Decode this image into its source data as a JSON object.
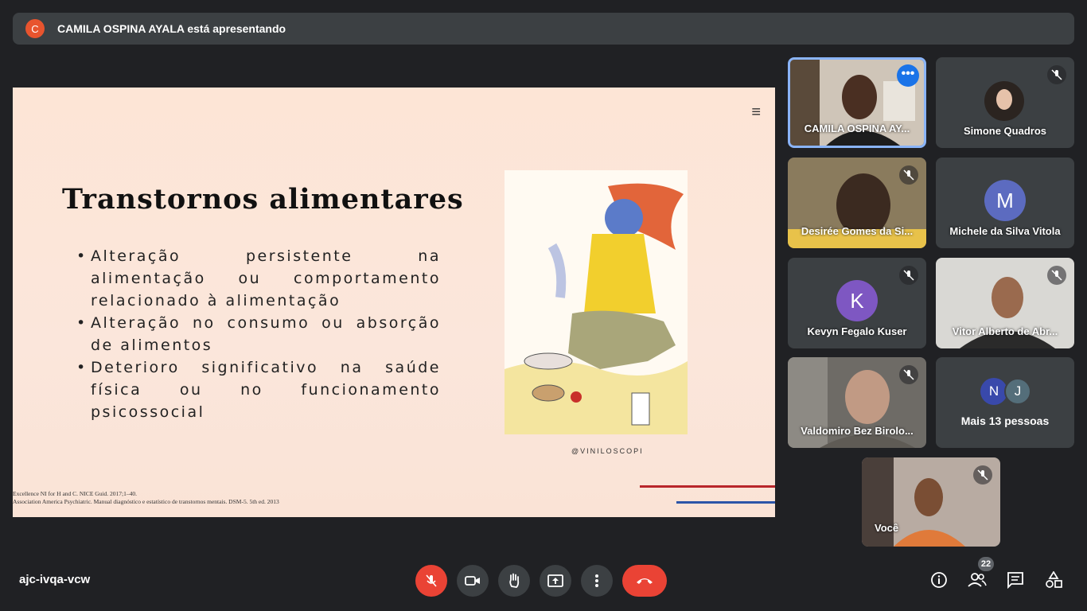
{
  "banner": {
    "avatar_letter": "C",
    "text": "CAMILA OSPINA AYALA está apresentando"
  },
  "slide": {
    "title": "Transtornos alimentares",
    "bullets": [
      "Alteração persistente na alimentação ou comportamento relacionado à alimentação",
      " Alteração no consumo ou absorção de alimentos",
      "Deterioro significativo na saúde física ou no funcionamento psicossocial"
    ],
    "credit": "@VINILOSCOPI",
    "refs": [
      "Excellence NI for H and C. NICE Guid. 2017;1–40.",
      "Association America Psychiatric. Manual diagnóstico e estatístico de transtornos mentais. DSM-5. 5th ed. 2013"
    ]
  },
  "participants": [
    {
      "name": "CAMILA OSPINA AY...",
      "active": true
    },
    {
      "name": "Simone Quadros"
    },
    {
      "name": "Desirée Gomes da Si..."
    },
    {
      "name": "Michele da Silva Vitola",
      "avatar_letter": "M"
    },
    {
      "name": "Kevyn Fegalo Kuser",
      "avatar_letter": "K"
    },
    {
      "name": "Vitor Alberto de Abr..."
    },
    {
      "name": "Valdomiro Bez Birolo..."
    },
    {
      "name": "Mais 13 pessoas",
      "avatars": [
        "N",
        "J"
      ]
    },
    {
      "name": "Você"
    }
  ],
  "bottom": {
    "meeting_code": "ajc-ivqa-vcw",
    "people_count": "22"
  },
  "colors": {
    "accent": "#1a73e8",
    "danger": "#ea4335",
    "surface": "#3c4043",
    "bg": "#202124"
  }
}
